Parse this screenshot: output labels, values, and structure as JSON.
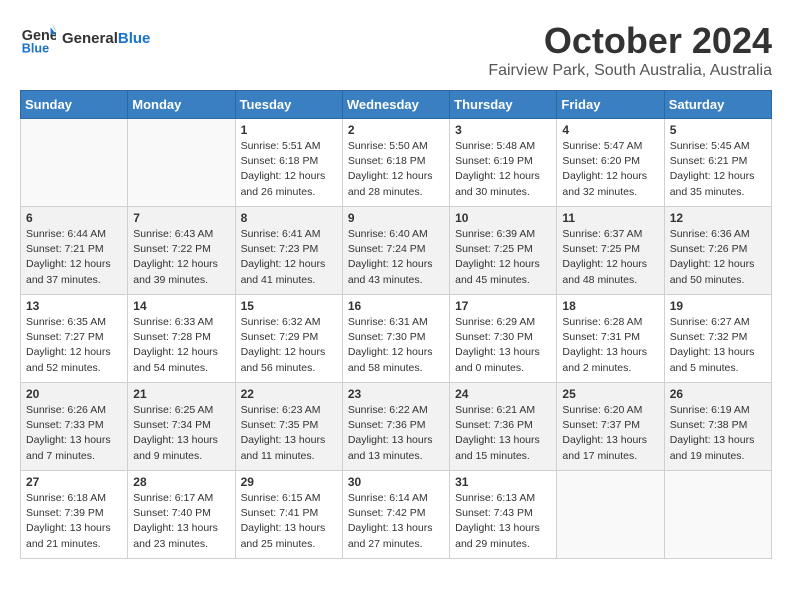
{
  "header": {
    "logo_line1": "General",
    "logo_line2": "Blue",
    "month": "October 2024",
    "location": "Fairview Park, South Australia, Australia"
  },
  "days_of_week": [
    "Sunday",
    "Monday",
    "Tuesday",
    "Wednesday",
    "Thursday",
    "Friday",
    "Saturday"
  ],
  "weeks": [
    [
      {
        "day": "",
        "info": "",
        "empty": true
      },
      {
        "day": "",
        "info": "",
        "empty": true
      },
      {
        "day": "1",
        "info": "Sunrise: 5:51 AM\nSunset: 6:18 PM\nDaylight: 12 hours\nand 26 minutes.",
        "empty": false
      },
      {
        "day": "2",
        "info": "Sunrise: 5:50 AM\nSunset: 6:18 PM\nDaylight: 12 hours\nand 28 minutes.",
        "empty": false
      },
      {
        "day": "3",
        "info": "Sunrise: 5:48 AM\nSunset: 6:19 PM\nDaylight: 12 hours\nand 30 minutes.",
        "empty": false
      },
      {
        "day": "4",
        "info": "Sunrise: 5:47 AM\nSunset: 6:20 PM\nDaylight: 12 hours\nand 32 minutes.",
        "empty": false
      },
      {
        "day": "5",
        "info": "Sunrise: 5:45 AM\nSunset: 6:21 PM\nDaylight: 12 hours\nand 35 minutes.",
        "empty": false
      }
    ],
    [
      {
        "day": "6",
        "info": "Sunrise: 6:44 AM\nSunset: 7:21 PM\nDaylight: 12 hours\nand 37 minutes.",
        "empty": false,
        "shaded": true
      },
      {
        "day": "7",
        "info": "Sunrise: 6:43 AM\nSunset: 7:22 PM\nDaylight: 12 hours\nand 39 minutes.",
        "empty": false,
        "shaded": true
      },
      {
        "day": "8",
        "info": "Sunrise: 6:41 AM\nSunset: 7:23 PM\nDaylight: 12 hours\nand 41 minutes.",
        "empty": false,
        "shaded": true
      },
      {
        "day": "9",
        "info": "Sunrise: 6:40 AM\nSunset: 7:24 PM\nDaylight: 12 hours\nand 43 minutes.",
        "empty": false,
        "shaded": true
      },
      {
        "day": "10",
        "info": "Sunrise: 6:39 AM\nSunset: 7:25 PM\nDaylight: 12 hours\nand 45 minutes.",
        "empty": false,
        "shaded": true
      },
      {
        "day": "11",
        "info": "Sunrise: 6:37 AM\nSunset: 7:25 PM\nDaylight: 12 hours\nand 48 minutes.",
        "empty": false,
        "shaded": true
      },
      {
        "day": "12",
        "info": "Sunrise: 6:36 AM\nSunset: 7:26 PM\nDaylight: 12 hours\nand 50 minutes.",
        "empty": false,
        "shaded": true
      }
    ],
    [
      {
        "day": "13",
        "info": "Sunrise: 6:35 AM\nSunset: 7:27 PM\nDaylight: 12 hours\nand 52 minutes.",
        "empty": false
      },
      {
        "day": "14",
        "info": "Sunrise: 6:33 AM\nSunset: 7:28 PM\nDaylight: 12 hours\nand 54 minutes.",
        "empty": false
      },
      {
        "day": "15",
        "info": "Sunrise: 6:32 AM\nSunset: 7:29 PM\nDaylight: 12 hours\nand 56 minutes.",
        "empty": false
      },
      {
        "day": "16",
        "info": "Sunrise: 6:31 AM\nSunset: 7:30 PM\nDaylight: 12 hours\nand 58 minutes.",
        "empty": false
      },
      {
        "day": "17",
        "info": "Sunrise: 6:29 AM\nSunset: 7:30 PM\nDaylight: 13 hours\nand 0 minutes.",
        "empty": false
      },
      {
        "day": "18",
        "info": "Sunrise: 6:28 AM\nSunset: 7:31 PM\nDaylight: 13 hours\nand 2 minutes.",
        "empty": false
      },
      {
        "day": "19",
        "info": "Sunrise: 6:27 AM\nSunset: 7:32 PM\nDaylight: 13 hours\nand 5 minutes.",
        "empty": false
      }
    ],
    [
      {
        "day": "20",
        "info": "Sunrise: 6:26 AM\nSunset: 7:33 PM\nDaylight: 13 hours\nand 7 minutes.",
        "empty": false,
        "shaded": true
      },
      {
        "day": "21",
        "info": "Sunrise: 6:25 AM\nSunset: 7:34 PM\nDaylight: 13 hours\nand 9 minutes.",
        "empty": false,
        "shaded": true
      },
      {
        "day": "22",
        "info": "Sunrise: 6:23 AM\nSunset: 7:35 PM\nDaylight: 13 hours\nand 11 minutes.",
        "empty": false,
        "shaded": true
      },
      {
        "day": "23",
        "info": "Sunrise: 6:22 AM\nSunset: 7:36 PM\nDaylight: 13 hours\nand 13 minutes.",
        "empty": false,
        "shaded": true
      },
      {
        "day": "24",
        "info": "Sunrise: 6:21 AM\nSunset: 7:36 PM\nDaylight: 13 hours\nand 15 minutes.",
        "empty": false,
        "shaded": true
      },
      {
        "day": "25",
        "info": "Sunrise: 6:20 AM\nSunset: 7:37 PM\nDaylight: 13 hours\nand 17 minutes.",
        "empty": false,
        "shaded": true
      },
      {
        "day": "26",
        "info": "Sunrise: 6:19 AM\nSunset: 7:38 PM\nDaylight: 13 hours\nand 19 minutes.",
        "empty": false,
        "shaded": true
      }
    ],
    [
      {
        "day": "27",
        "info": "Sunrise: 6:18 AM\nSunset: 7:39 PM\nDaylight: 13 hours\nand 21 minutes.",
        "empty": false
      },
      {
        "day": "28",
        "info": "Sunrise: 6:17 AM\nSunset: 7:40 PM\nDaylight: 13 hours\nand 23 minutes.",
        "empty": false
      },
      {
        "day": "29",
        "info": "Sunrise: 6:15 AM\nSunset: 7:41 PM\nDaylight: 13 hours\nand 25 minutes.",
        "empty": false
      },
      {
        "day": "30",
        "info": "Sunrise: 6:14 AM\nSunset: 7:42 PM\nDaylight: 13 hours\nand 27 minutes.",
        "empty": false
      },
      {
        "day": "31",
        "info": "Sunrise: 6:13 AM\nSunset: 7:43 PM\nDaylight: 13 hours\nand 29 minutes.",
        "empty": false
      },
      {
        "day": "",
        "info": "",
        "empty": true
      },
      {
        "day": "",
        "info": "",
        "empty": true
      }
    ]
  ]
}
